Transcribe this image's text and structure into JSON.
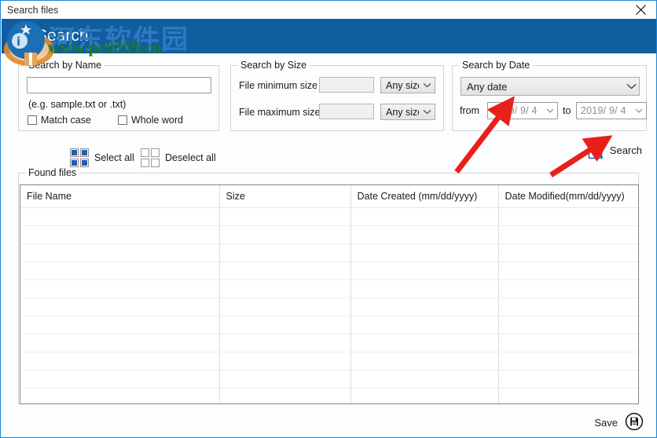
{
  "window": {
    "title": "Search files",
    "close_label": "×",
    "banner_title": "Search"
  },
  "search_by_name": {
    "legend": "Search by Name",
    "input_value": "",
    "input_placeholder": "",
    "hint": "(e.g. sample.txt or .txt)",
    "match_case_label": "Match case",
    "whole_word_label": "Whole word"
  },
  "search_by_size": {
    "legend": "Search by Size",
    "min_label": "File minimum size",
    "min_value": "",
    "min_unit": "Any size",
    "max_label": "File maximum size",
    "max_value": "",
    "max_unit": "Any size"
  },
  "search_by_date": {
    "legend": "Search by Date",
    "mode": "Any date",
    "from_label": "from",
    "from_value": "2019/ 9/ 4",
    "to_label": "to",
    "to_value": "2019/ 9/ 4"
  },
  "toolbar": {
    "select_all_label": "Select all",
    "select_all_icon": "grid-filled-icon",
    "deselect_all_label": "Deselect all",
    "deselect_all_icon": "grid-empty-icon",
    "search_label": "Search",
    "search_icon": "document-magnifier-icon"
  },
  "found_files": {
    "legend": "Found files",
    "columns": [
      "File Name",
      "Size",
      "Date Created (mm/dd/yyyy)",
      "Date Modified(mm/dd/yyyy)"
    ],
    "rows": [],
    "empty_row_count": 12
  },
  "footer": {
    "save_label": "Save",
    "save_icon": "floppy-disk-icon"
  },
  "watermark": {
    "cn_text": "河东软件园",
    "url_text": "www.pc0359.cn"
  },
  "colors": {
    "banner_blue": "#105DA0",
    "window_border": "#1e86d4",
    "icon_blue": "#1F5FA8",
    "annotation_red": "#E8201A",
    "watermark_green": "#1f7a1f"
  }
}
